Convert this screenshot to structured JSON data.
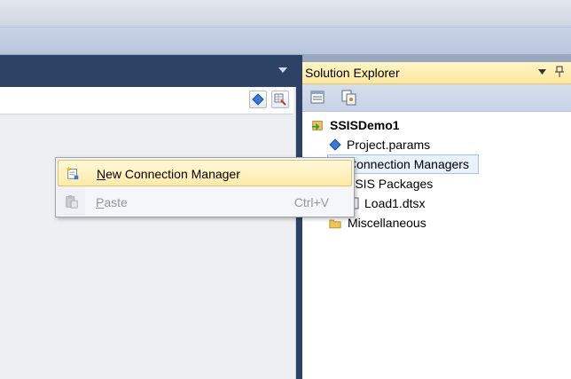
{
  "solution_explorer": {
    "title": "Solution Explorer",
    "tree": {
      "project": "SSISDemo1",
      "items": [
        "Project.params",
        "Connection Managers",
        "SSIS Packages",
        "Load1.dtsx",
        "Miscellaneous"
      ]
    }
  },
  "context_menu": {
    "items": [
      {
        "label": "New Connection Manager",
        "accel": "N",
        "rest": "ew Connection Manager",
        "state": "highlighted"
      },
      {
        "label": "Paste",
        "accel": "P",
        "rest": "aste",
        "shortcut": "Ctrl+V",
        "state": "disabled"
      }
    ]
  },
  "colors": {
    "tab_bar": "#2e4266",
    "header_highlight": "#ffe79e",
    "menu_highlight": "#ffeaa8",
    "disabled_text": "#9097a3"
  },
  "icons": {
    "project": "project-icon",
    "params": "params-icon",
    "folder": "folder-icon",
    "package": "package-icon"
  }
}
